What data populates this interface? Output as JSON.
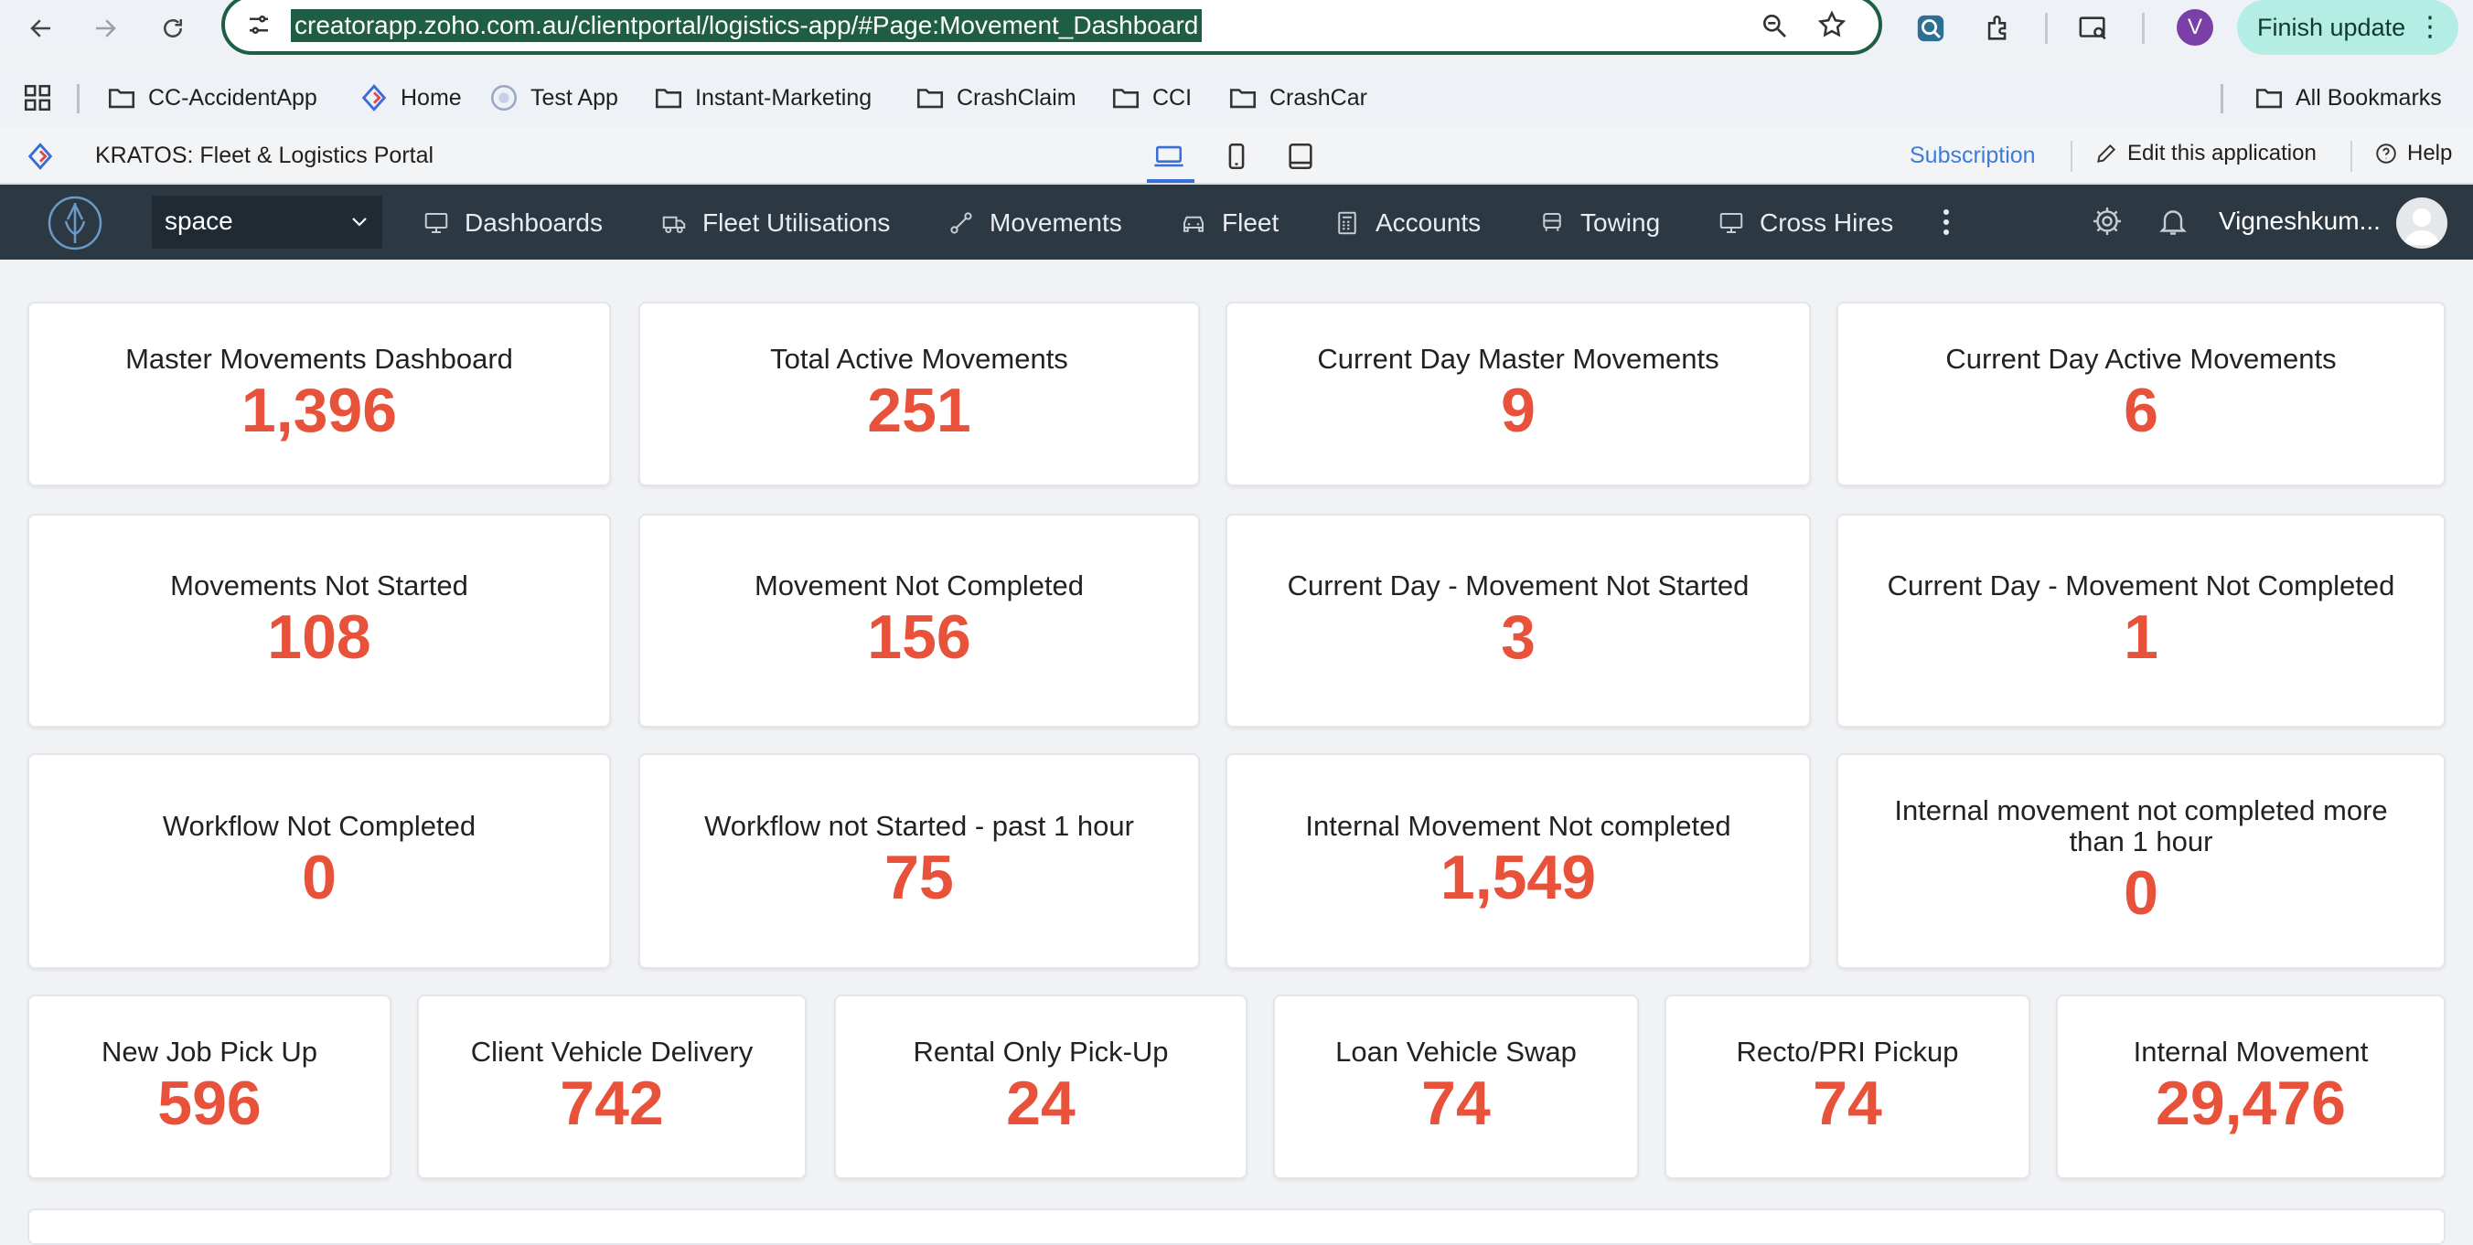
{
  "browser": {
    "url": "creatorapp.zoho.com.au/clientportal/logistics-app/#Page:Movement_Dashboard",
    "profile_initial": "V",
    "finish_update_label": "Finish update"
  },
  "bookmarks": {
    "items": [
      {
        "label": "CC-AccidentApp",
        "icon": "folder-icon"
      },
      {
        "label": "Home",
        "icon": "zoho-creator-icon"
      },
      {
        "label": "Test App",
        "icon": "app-icon"
      },
      {
        "label": "Instant-Marketing",
        "icon": "folder-icon"
      },
      {
        "label": "CrashClaim",
        "icon": "folder-icon"
      },
      {
        "label": "CCI",
        "icon": "folder-icon"
      },
      {
        "label": "CrashCar",
        "icon": "folder-icon"
      }
    ],
    "all_bookmarks_label": "All Bookmarks"
  },
  "app_header": {
    "title": "KRATOS: Fleet & Logistics Portal",
    "subscription_label": "Subscription",
    "edit_label": "Edit this application",
    "help_label": "Help"
  },
  "nav": {
    "space_value": "space",
    "items": [
      {
        "label": "Dashboards",
        "icon": "monitor-icon"
      },
      {
        "label": "Fleet Utilisations",
        "icon": "truck-icon"
      },
      {
        "label": "Movements",
        "icon": "route-icon"
      },
      {
        "label": "Fleet",
        "icon": "car-icon"
      },
      {
        "label": "Accounts",
        "icon": "calculator-icon"
      },
      {
        "label": "Towing",
        "icon": "tow-truck-icon"
      },
      {
        "label": "Cross Hires",
        "icon": "monitor-icon"
      }
    ],
    "user_name": "Vigneshkum..."
  },
  "cards": {
    "row1": [
      {
        "label": "Master Movements Dashboard",
        "value": "1,396"
      },
      {
        "label": "Total Active Movements",
        "value": "251"
      },
      {
        "label": "Current Day Master Movements",
        "value": "9"
      },
      {
        "label": "Current Day Active Movements",
        "value": "6"
      }
    ],
    "row2": [
      {
        "label": "Movements Not Started",
        "value": "108"
      },
      {
        "label": "Movement Not Completed",
        "value": "156"
      },
      {
        "label": "Current Day - Movement Not Started",
        "value": "3"
      },
      {
        "label": "Current Day - Movement Not Completed",
        "value": "1"
      }
    ],
    "row3": [
      {
        "label": "Workflow Not Completed",
        "value": "0"
      },
      {
        "label": "Workflow not Started - past 1 hour",
        "value": "75"
      },
      {
        "label": "Internal Movement Not completed",
        "value": "1,549"
      },
      {
        "label": "Internal movement not completed more than 1 hour",
        "value": "0"
      }
    ],
    "row4": [
      {
        "label": "New Job Pick Up",
        "value": "596"
      },
      {
        "label": "Client Vehicle Delivery",
        "value": "742"
      },
      {
        "label": "Rental Only Pick-Up",
        "value": "24"
      },
      {
        "label": "Loan Vehicle Swap",
        "value": "74"
      },
      {
        "label": "Recto/PRI Pickup",
        "value": "74"
      },
      {
        "label": "Internal Movement",
        "value": "29,476"
      }
    ]
  },
  "colors": {
    "accent_value": "#e8513a",
    "nav_bg": "#2c3842",
    "link": "#3d7bd9"
  }
}
